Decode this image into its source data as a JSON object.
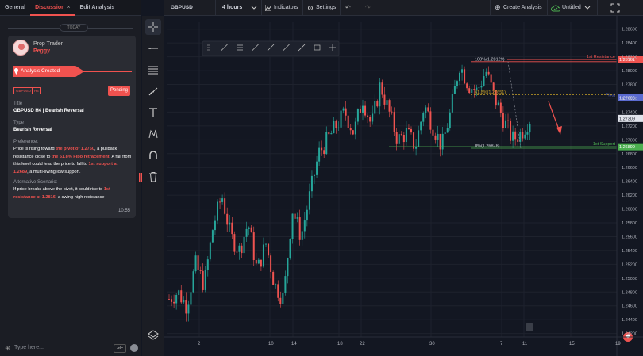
{
  "tabs": [
    {
      "label": "General"
    },
    {
      "label": "Discussion",
      "close": "×"
    },
    {
      "label": "Edit Analysis"
    }
  ],
  "feed": {
    "today_label": "TODAY",
    "card": {
      "role": "Prop Trader",
      "name": "Peggy",
      "banner": "Analysis Created",
      "chip_symbol": "GBPUSD",
      "chip_tf": "H4",
      "status": "Pending",
      "title_label": "Title",
      "title_value": "GBPUSD H4 | Bearish Reversal",
      "type_label": "Type",
      "type_value": "Bearish Reversal",
      "pref_label": "Preference:",
      "pref_parts": [
        " Price is rising toward ",
        "the pivot of 1.2760",
        ", a pullback resistance close to ",
        "the 61.8% Fibo retracement",
        ". A fall from this level could lead the price to fall to ",
        "1st support at 1.2689",
        ", a multi-swing low support."
      ],
      "alt_label": "Alternative Scenario:",
      "alt_parts": [
        " If price breaks above the pivot, it could rise to ",
        "1st resistance at 1.2816",
        ", a swing-high resistance"
      ],
      "time": "10:55"
    },
    "input_placeholder": "Type here...",
    "gif_label": "GIF"
  },
  "header": {
    "symbol": "GBPUSD",
    "timeframe": "4 hours",
    "indicators": "Indicators",
    "settings": "Settings",
    "create": "Create Analysis",
    "layout": "Untitled"
  },
  "tools": [
    "crosshair-icon",
    "horizontal-line-icon",
    "fib-retracement-icon",
    "brush-icon",
    "text-icon",
    "pattern-icon",
    "magnet-icon",
    "trash-icon",
    "layers-icon"
  ],
  "colors": {
    "up": "#26a69a",
    "down": "#ef5350",
    "accent": "#f0524f",
    "pivot": "#5b6bd0",
    "support": "#4caf50",
    "fib": "#c9a227"
  },
  "chart_data": {
    "type": "candlestick",
    "symbol": "GBPUSD",
    "timeframe": "H4",
    "ylim": [
      1.2415,
      1.287
    ],
    "y_ticks": [
      "1.28600",
      "1.28400",
      "1.28200",
      "1.28000",
      "1.27800",
      "1.27600",
      "1.27400",
      "1.27200",
      "1.27000",
      "1.26800",
      "1.26600",
      "1.26400",
      "1.26200",
      "1.26000",
      "1.25800",
      "1.25600",
      "1.25400",
      "1.25200",
      "1.25000",
      "1.24800",
      "1.24600",
      "1.24400",
      "1.24200"
    ],
    "x_ticks": [
      "2",
      "10",
      "14",
      "18",
      "22",
      "30",
      "7",
      "11",
      "15",
      "19"
    ],
    "levels": [
      {
        "name": "1st Resistance",
        "value": 1.28161,
        "label": "1.28161"
      },
      {
        "name": "Pivot",
        "value": 1.27606,
        "label": "1.27606"
      },
      {
        "name": "1st Support",
        "value": 1.26899,
        "label": "1.26899"
      }
    ],
    "current_price": "1.27309",
    "fib": [
      {
        "label": "100%(1.28129)",
        "value": 1.28129
      },
      {
        "label": "61.8%(1.27651)",
        "value": 1.27651
      },
      {
        "label": "0%(1.26878)",
        "value": 1.26878
      }
    ],
    "trend_path": [
      1.247,
      1.248,
      1.246,
      1.252,
      1.249,
      1.2575,
      1.262,
      1.256,
      1.254,
      1.258,
      1.251,
      1.255,
      1.249,
      1.247,
      1.26,
      1.256,
      1.262,
      1.268,
      1.27,
      1.272,
      1.274,
      1.271,
      1.276,
      1.272,
      1.278,
      1.274,
      1.27,
      1.271,
      1.269,
      1.275,
      1.272,
      1.269,
      1.274,
      1.281,
      1.278,
      1.277,
      1.28,
      1.276,
      1.273,
      1.27,
      1.271,
      1.273
    ]
  }
}
